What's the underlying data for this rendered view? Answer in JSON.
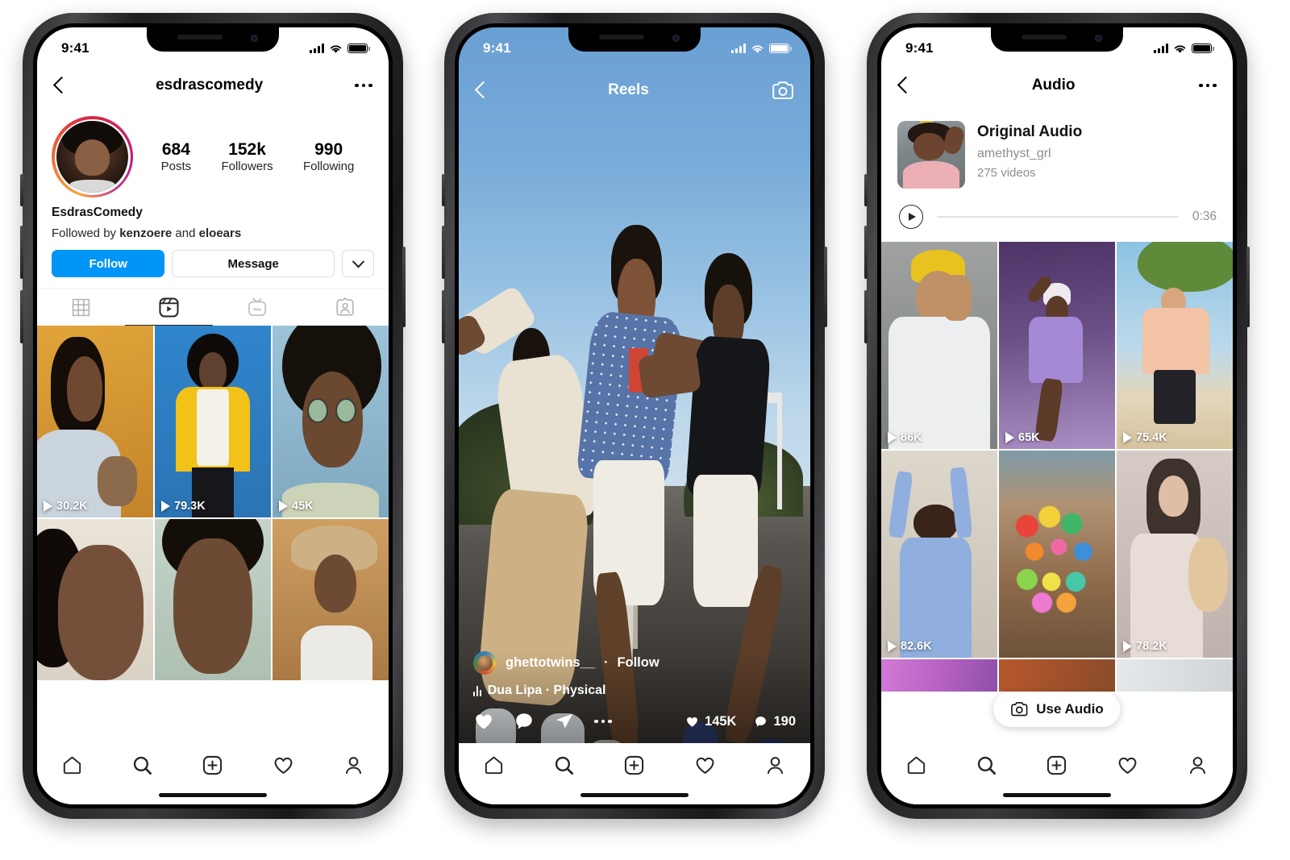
{
  "phones": {
    "profile": {
      "status": {
        "time": "9:41",
        "signal_icon": "cellular-bars-icon",
        "wifi_icon": "wifi-icon",
        "battery_icon": "battery-icon"
      },
      "nav": {
        "back_icon": "back-chevron-icon",
        "title": "esdrascomedy",
        "more_icon": "more-options-icon"
      },
      "avatar_name": "profile-avatar",
      "stats": [
        {
          "number": "684",
          "label": "Posts"
        },
        {
          "number": "152k",
          "label": "Followers"
        },
        {
          "number": "990",
          "label": "Following"
        }
      ],
      "display_name": "EsdrasComedy",
      "followed_by_prefix": "Followed by ",
      "followed_by_1": "kenzoere",
      "followed_by_mid": " and ",
      "followed_by_2": "eloears",
      "buttons": {
        "follow": "Follow",
        "message": "Message",
        "more_icon": "chevron-down-icon"
      },
      "tabs": [
        {
          "name": "grid-tab",
          "icon": "grid-icon",
          "active": false
        },
        {
          "name": "reels-tab",
          "icon": "reels-icon",
          "active": true
        },
        {
          "name": "igtv-tab",
          "icon": "igtv-icon",
          "active": false
        },
        {
          "name": "tagged-tab",
          "icon": "tagged-icon",
          "active": false
        }
      ],
      "grid": [
        {
          "views": "30.2K",
          "bg": "#d8952f"
        },
        {
          "views": "79.3K",
          "bg": "#2f7fc4"
        },
        {
          "views": "45K",
          "bg": "#7fb5cf"
        },
        {
          "views": "",
          "bg": "#e6e0d6"
        },
        {
          "views": "",
          "bg": "#b9c9bf"
        },
        {
          "views": "",
          "bg": "#c79a5a"
        }
      ],
      "tabbar": [
        "home-icon",
        "search-icon",
        "add-post-icon",
        "activity-heart-icon",
        "profile-person-icon"
      ]
    },
    "reels": {
      "status": {
        "time": "9:41",
        "signal_icon": "cellular-bars-icon",
        "wifi_icon": "wifi-icon",
        "battery_icon": "battery-icon"
      },
      "nav": {
        "back_icon": "back-chevron-icon",
        "title": "Reels",
        "camera_icon": "camera-icon"
      },
      "username": "ghettotwins__",
      "separator": "·",
      "follow_label": "Follow",
      "audio_icon": "audio-equalizer-icon",
      "audio_text": "Dua Lipa · Physical",
      "actions": [
        "like-heart-icon",
        "comment-bubble-icon",
        "share-paperplane-icon",
        "more-options-icon"
      ],
      "like_count": "145K",
      "comment_count": "190",
      "tabbar": [
        "home-icon",
        "search-icon",
        "add-post-icon",
        "activity-heart-icon",
        "profile-person-icon"
      ]
    },
    "audio": {
      "status": {
        "time": "9:41",
        "signal_icon": "cellular-bars-icon",
        "wifi_icon": "wifi-icon",
        "battery_icon": "battery-icon"
      },
      "nav": {
        "back_icon": "back-chevron-icon",
        "title": "Audio",
        "more_icon": "more-options-icon"
      },
      "card": {
        "thumb_name": "audio-cover-thumbnail",
        "title": "Original Audio",
        "author": "amethyst_grl",
        "video_count": "275 videos"
      },
      "player": {
        "play_icon": "play-button-icon",
        "duration": "0:36"
      },
      "grid": [
        {
          "views": "86K",
          "bg": "#8d8f8c"
        },
        {
          "views": "65K",
          "bg": "#6b4f86"
        },
        {
          "views": "75.4K",
          "bg": "#8dc0de"
        },
        {
          "views": "82.6K",
          "bg": "#cfc7bb"
        },
        {
          "views": "",
          "bg": "#9c7a56"
        },
        {
          "views": "78.2K",
          "bg": "#c6b6b2"
        },
        {
          "views": "",
          "bg": "#c58fd8"
        },
        {
          "views": "",
          "bg": "#b8572c"
        },
        {
          "views": "",
          "bg": "#dfe2e4"
        }
      ],
      "use_audio": {
        "icon": "camera-icon",
        "label": "Use Audio"
      },
      "tabbar": [
        "home-icon",
        "search-icon",
        "add-post-icon",
        "activity-heart-icon",
        "profile-person-icon"
      ]
    }
  },
  "colors": {
    "accent": "#0095f6",
    "text": "#121212",
    "muted": "#8e8e8e",
    "bg": "#ffffff"
  }
}
